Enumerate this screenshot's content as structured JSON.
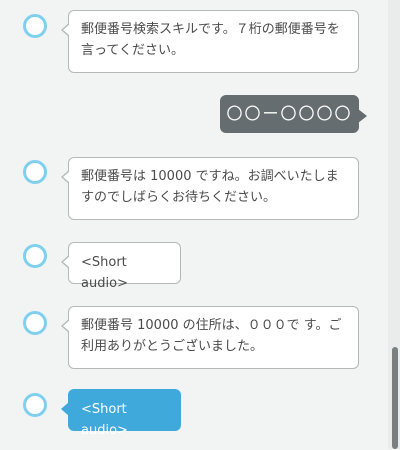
{
  "conversation": {
    "messages": [
      {
        "sender": "alexa",
        "text": "郵便番号検索スキルです。７桁の郵便番号を言ってください。"
      },
      {
        "sender": "user",
        "text": "〇〇ー〇〇〇〇"
      },
      {
        "sender": "alexa",
        "text": "郵便番号は 10000 ですね。お調べいたしますのでしばらくお待ちください。"
      },
      {
        "sender": "alexa",
        "text": "<Short audio>"
      },
      {
        "sender": "alexa",
        "text": "郵便番号 10000 の住所は、０００で す。ご利用ありがとうございました。"
      },
      {
        "sender": "alexa",
        "text": "<Short audio>",
        "highlighted": true
      }
    ]
  },
  "colors": {
    "background": "#f2f3f3",
    "avatar_ring": "#7fd0ee",
    "user_bubble": "#666d70",
    "highlight_bubble": "#3fa9dc",
    "bubble_border": "#b5b8b8"
  },
  "icons": {
    "avatar": "alexa-ring-icon"
  }
}
